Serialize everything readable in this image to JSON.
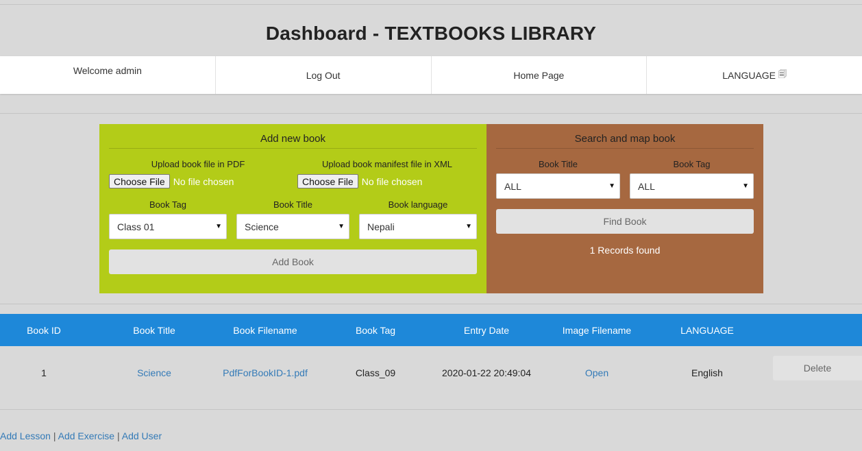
{
  "header": {
    "title": "Dashboard - TEXTBOOKS LIBRARY"
  },
  "nav": {
    "welcome": "Welcome admin",
    "logout": "Log Out",
    "home": "Home Page",
    "language": "LANGUAGE"
  },
  "add_panel": {
    "title": "Add new book",
    "pdf_label": "Upload book file in PDF",
    "xml_label": "Upload book manifest file in XML",
    "choose_file": "Choose File",
    "no_file": "No file chosen",
    "tag_label": "Book Tag",
    "title_label": "Book Title",
    "lang_label": "Book language",
    "tag_value": "Class 01",
    "title_value": "Science",
    "lang_value": "Nepali",
    "add_button": "Add Book",
    "bg_color": "#b3cc18"
  },
  "search_panel": {
    "title": "Search and map book",
    "title_label": "Book Title",
    "tag_label": "Book Tag",
    "title_value": "ALL",
    "tag_value": "ALL",
    "find_button": "Find Book",
    "records": "1 Records found",
    "bg_color": "#a66840"
  },
  "table": {
    "header_color": "#1e88d9",
    "columns": [
      "Book ID",
      "Book Title",
      "Book Filename",
      "Book Tag",
      "Entry Date",
      "Image Filename",
      "LANGUAGE"
    ],
    "rows": [
      {
        "id": "1",
        "title": "Science",
        "filename": "PdfForBookID-1.pdf",
        "tag": "Class_09",
        "date": "2020-01-22 20:49:04",
        "image": "Open",
        "language": "English",
        "action": "Delete"
      }
    ]
  },
  "footer": {
    "add_lesson": "Add Lesson",
    "add_exercise": "Add Exercise",
    "add_user": "Add User",
    "separator": "|"
  }
}
